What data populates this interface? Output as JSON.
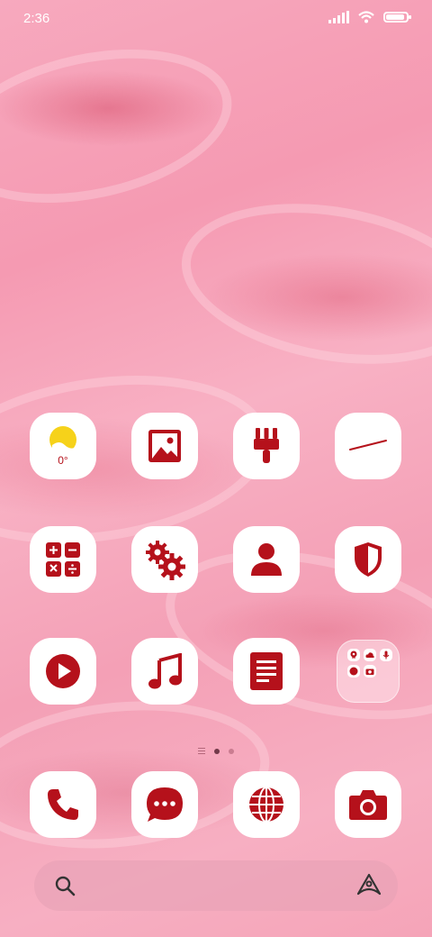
{
  "status_bar": {
    "time": "2:36"
  },
  "apps": {
    "weather": {
      "temperature": "0°"
    }
  },
  "search": {
    "placeholder": ""
  },
  "colors": {
    "accent": "#b5111b",
    "icon_bg": "#ffffff",
    "sun": "#f6d21a"
  }
}
